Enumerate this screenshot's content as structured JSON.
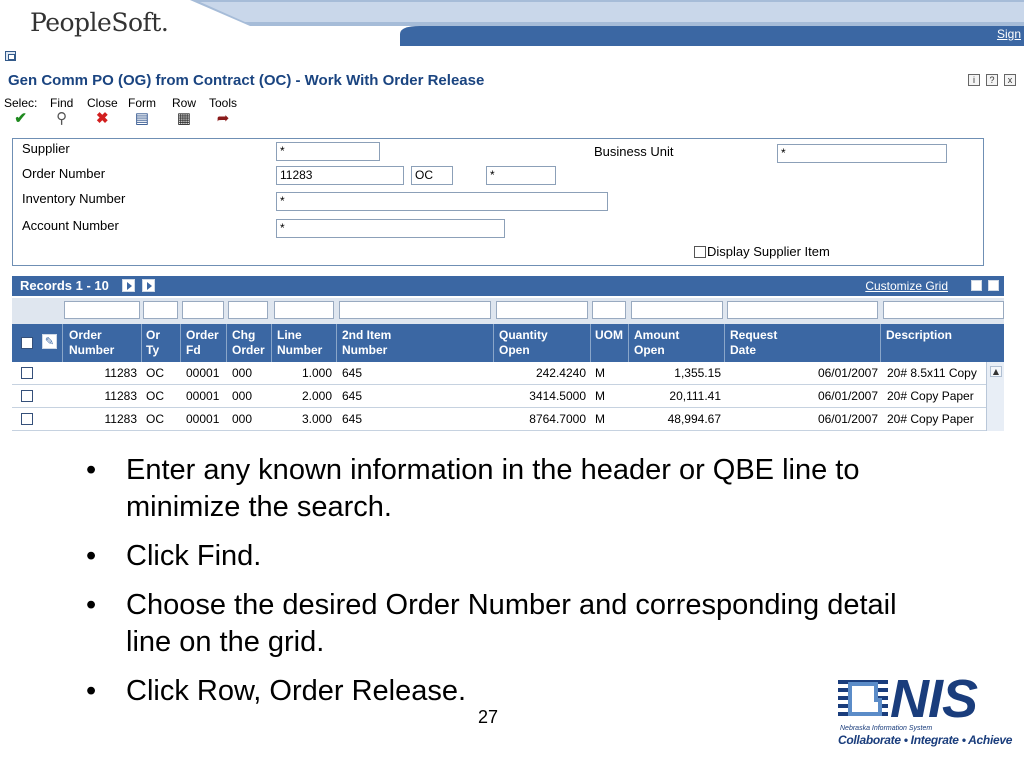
{
  "app": {
    "brand": "PeopleSoft.",
    "sign_out": "Sign",
    "title": "Gen Comm PO (OG) from Contract (OC) - Work With Order Release",
    "title_icons": [
      "i",
      "?",
      "x"
    ]
  },
  "toolbar": {
    "items": [
      {
        "label": "Selec:",
        "icon": "check-icon"
      },
      {
        "label": "Find",
        "icon": "find-icon"
      },
      {
        "label": "Close",
        "icon": "close-icon"
      },
      {
        "label": "Form",
        "icon": "form-icon"
      },
      {
        "label": "Row",
        "icon": "row-icon"
      },
      {
        "label": "Tools",
        "icon": "tools-icon"
      }
    ]
  },
  "header": {
    "supplier_label": "Supplier",
    "supplier_value": "*",
    "order_number_label": "Order Number",
    "order_number_value": "11283",
    "order_type_value": "OC",
    "order_company_value": "*",
    "inventory_number_label": "Inventory Number",
    "inventory_number_value": "*",
    "account_number_label": "Account Number",
    "account_number_value": "*",
    "business_unit_label": "Business Unit",
    "business_unit_value": "*",
    "display_supplier_item_label": "Display Supplier Item"
  },
  "grid": {
    "records_label": "Records 1 - 10",
    "customize_label": "Customize Grid",
    "columns": [
      {
        "line1": "Order",
        "line2": "Number"
      },
      {
        "line1": "Or",
        "line2": "Ty"
      },
      {
        "line1": "Order",
        "line2": "Fd"
      },
      {
        "line1": "Chg",
        "line2": "Order"
      },
      {
        "line1": "Line",
        "line2": "Number"
      },
      {
        "line1": "2nd Item",
        "line2": "Number"
      },
      {
        "line1": "Quantity",
        "line2": "Open"
      },
      {
        "line1": "UOM",
        "line2": ""
      },
      {
        "line1": "Amount",
        "line2": "Open"
      },
      {
        "line1": "Request",
        "line2": "Date"
      },
      {
        "line1": "Description",
        "line2": ""
      }
    ],
    "rows": [
      {
        "order_number": "11283",
        "or_ty": "OC",
        "order_fd": "00001",
        "chg_order": "000",
        "line_number": "1.000",
        "item_number": "645",
        "quantity_open": "242.4240",
        "uom": "M",
        "amount_open": "1,355.15",
        "request_date": "06/01/2007",
        "description": "20# 8.5x11 Copy"
      },
      {
        "order_number": "11283",
        "or_ty": "OC",
        "order_fd": "00001",
        "chg_order": "000",
        "line_number": "2.000",
        "item_number": "645",
        "quantity_open": "3414.5000",
        "uom": "M",
        "amount_open": "20,111.41",
        "request_date": "06/01/2007",
        "description": "20# Copy Paper"
      },
      {
        "order_number": "11283",
        "or_ty": "OC",
        "order_fd": "00001",
        "chg_order": "000",
        "line_number": "3.000",
        "item_number": "645",
        "quantity_open": "8764.7000",
        "uom": "M",
        "amount_open": "48,994.67",
        "request_date": "06/01/2007",
        "description": "20# Copy Paper"
      }
    ]
  },
  "slide": {
    "bullets": [
      "Enter any known information in the header or QBE line to minimize the search.",
      "Click Find.",
      "Choose the desired Order Number and corresponding detail line on the grid.",
      "Click Row, Order Release."
    ],
    "page_number": "27",
    "logo_text": "NIS",
    "logo_subtitle": "Nebraska Information System",
    "logo_tagline": "Collaborate • Integrate • Achieve"
  },
  "colors": {
    "banner_blue": "#3b67a3",
    "title_blue": "#1a4480",
    "logo_blue": "#1a3d7c"
  }
}
